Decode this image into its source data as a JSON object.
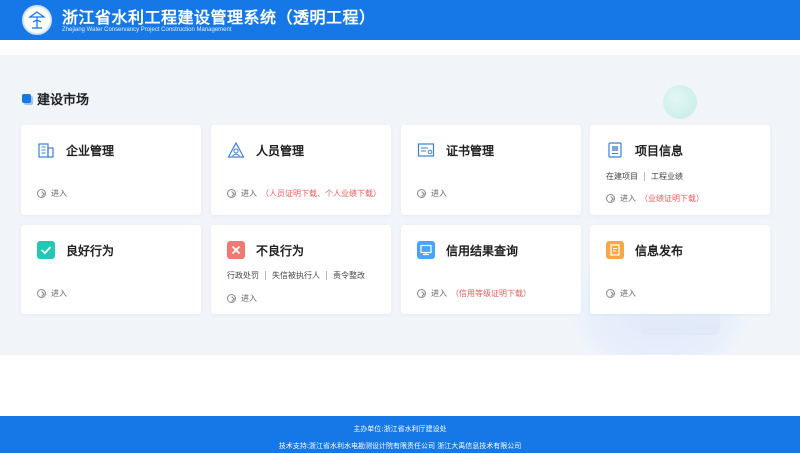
{
  "header": {
    "title": "浙江省水利工程建设管理系统（透明工程）",
    "subtitle": "Zhejiang Water Conservancy Project Construction Management"
  },
  "section": {
    "title": "建设市场"
  },
  "cards": [
    {
      "name": "企业管理",
      "icon": "building-icon",
      "enter": "进入",
      "note": ""
    },
    {
      "name": "人员管理",
      "icon": "person-triangle-icon",
      "enter": "进入",
      "note": "（人员证明下载、个人业绩下载）"
    },
    {
      "name": "证书管理",
      "icon": "certificate-icon",
      "enter": "进入",
      "note": ""
    },
    {
      "name": "项目信息",
      "icon": "project-doc-icon",
      "enter": "进入",
      "note": "（业绩证明下载）",
      "sublinks": [
        "在建项目",
        "工程业绩"
      ]
    },
    {
      "name": "良好行为",
      "icon": "check-icon",
      "enter": "进入",
      "note": "",
      "color": "#23c7b4"
    },
    {
      "name": "不良行为",
      "icon": "close-icon",
      "enter": "进入",
      "note": "",
      "color": "#f07a73",
      "sublinks": [
        "行政处罚",
        "失信被执行人",
        "责令整改"
      ]
    },
    {
      "name": "信用结果查询",
      "icon": "monitor-icon",
      "enter": "进入",
      "note": "（信用等级证明下载）",
      "color": "#4aa3f5"
    },
    {
      "name": "信息发布",
      "icon": "document-edit-icon",
      "enter": "进入",
      "note": "",
      "color": "#f5a84a"
    }
  ],
  "footer": {
    "line1": "主办单位:浙江省水利厅建设处",
    "line2": "技术支持:浙江省水利水电勘测设计院有限责任公司 浙江大禹信息技术有限公司"
  }
}
